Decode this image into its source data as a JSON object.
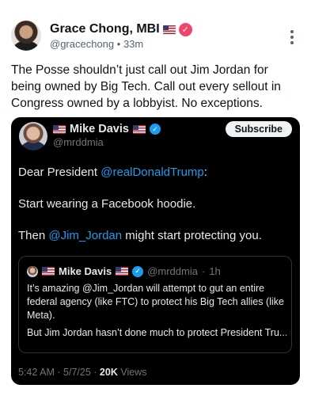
{
  "post": {
    "author_name": "Grace Chong, MBI",
    "handle": "@gracechong",
    "separator": "•",
    "time": "33m",
    "text": "The Posse shouldn’t just call out Jim Jordan for being owned by Big Tech. Call out every sellout in Congress owned by a lobbyist. No exceptions."
  },
  "embed": {
    "author_name": "Mike Davis",
    "handle": "@mrddmia",
    "subscribe_label": "Subscribe",
    "line1_prefix": "Dear President ",
    "line1_mention": "@realDonaldTrump",
    "line1_suffix": ":",
    "line2": "Start wearing a Facebook hoodie.",
    "line3_prefix": "Then ",
    "line3_mention": "@Jim_Jordan",
    "line3_suffix": " might start protecting you.",
    "quote": {
      "author_name": "Mike Davis",
      "handle": "@mrddmia",
      "separator": "·",
      "time": "1h",
      "text": "It’s amazing @Jim_Jordan will attempt to gut an entire federal agency (like FTC) to protect his Big Tech allies (like Meta).",
      "text2": "But Jim Jordan hasn’t done much to protect President Tru..."
    },
    "footer": {
      "time": "5:42 AM",
      "dot1": "·",
      "date": "5/7/25",
      "dot2": "·",
      "views_count": "20K",
      "views_label": "Views"
    }
  },
  "icons": {
    "flag": "us-flag-icon",
    "verified": "verified-badge-icon",
    "more": "more-vertical-icon"
  },
  "colors": {
    "link": "#1d9bf0",
    "badge": "#f0466c",
    "embed_bg": "#000000"
  }
}
